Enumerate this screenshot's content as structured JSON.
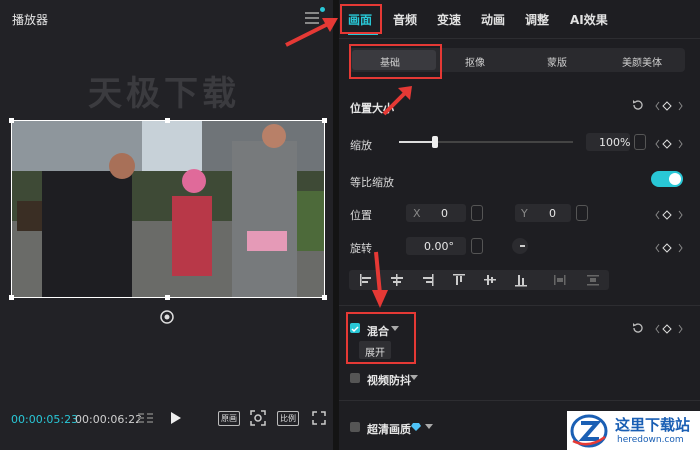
{
  "player": {
    "title": "播放器",
    "watermark": "天极下载",
    "time_current": "00:00:05:23",
    "time_total": "00:00:06:22",
    "original_label": "原画",
    "ratio_label": "比例"
  },
  "tabs": [
    {
      "label": "画面",
      "active": true
    },
    {
      "label": "音频"
    },
    {
      "label": "变速"
    },
    {
      "label": "动画"
    },
    {
      "label": "调整"
    },
    {
      "label": "AI效果"
    }
  ],
  "subtabs": [
    "基础",
    "抠像",
    "蒙版",
    "美颜美体"
  ],
  "position_size": {
    "title": "位置大小"
  },
  "scale": {
    "label": "缩放",
    "value": "100%",
    "level": 1.0
  },
  "uniform_scale": {
    "label": "等比缩放",
    "on": true
  },
  "position": {
    "label": "位置",
    "x_label": "X",
    "x_value": "0",
    "y_label": "Y",
    "y_value": "0"
  },
  "rotate": {
    "label": "旋转",
    "value": "0.00°"
  },
  "blend": {
    "label": "混合",
    "tooltip": "展开",
    "checked": true
  },
  "stabilize": {
    "label": "视频防抖"
  },
  "super_res": {
    "label": "超清画质"
  },
  "logo": {
    "text": "这里下载站",
    "subtext": "heredown.com"
  },
  "colors": {
    "accent": "#29c7d6",
    "annotation": "#e53935"
  }
}
